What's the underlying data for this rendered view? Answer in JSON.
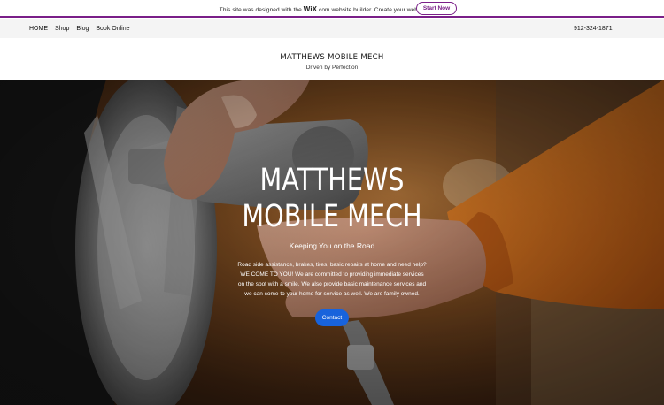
{
  "wix_banner": {
    "text_before": "This site was designed with the ",
    "logo": "WiX",
    "logo_suffix": ".com",
    "text_after": " website builder. Create your website today.",
    "button": "Start Now"
  },
  "nav": {
    "items": [
      "HOME",
      "Shop",
      "Blog",
      "Book Online"
    ],
    "phone": "912-324-1871"
  },
  "header": {
    "title": "MATTHEWS MOBILE MECH",
    "subtitle": "Driven by Perfection"
  },
  "hero": {
    "title_line1": "MATTHEWS",
    "title_line2": "MOBILE MECH",
    "tagline": "Keeping You on the Road",
    "description": "Road side assistance, brakes, tires, basic repairs at home and need help? WE COME TO YOU! We are committed to providing immediate services on the spot with a smile. We also provide basic maintenance services and we can come to your home for service as well. We are family owned.",
    "button": "Contact"
  },
  "colors": {
    "wix_accent": "#7a1f88",
    "contact_button": "#1863dc",
    "glove_orange": "#e8781e"
  }
}
